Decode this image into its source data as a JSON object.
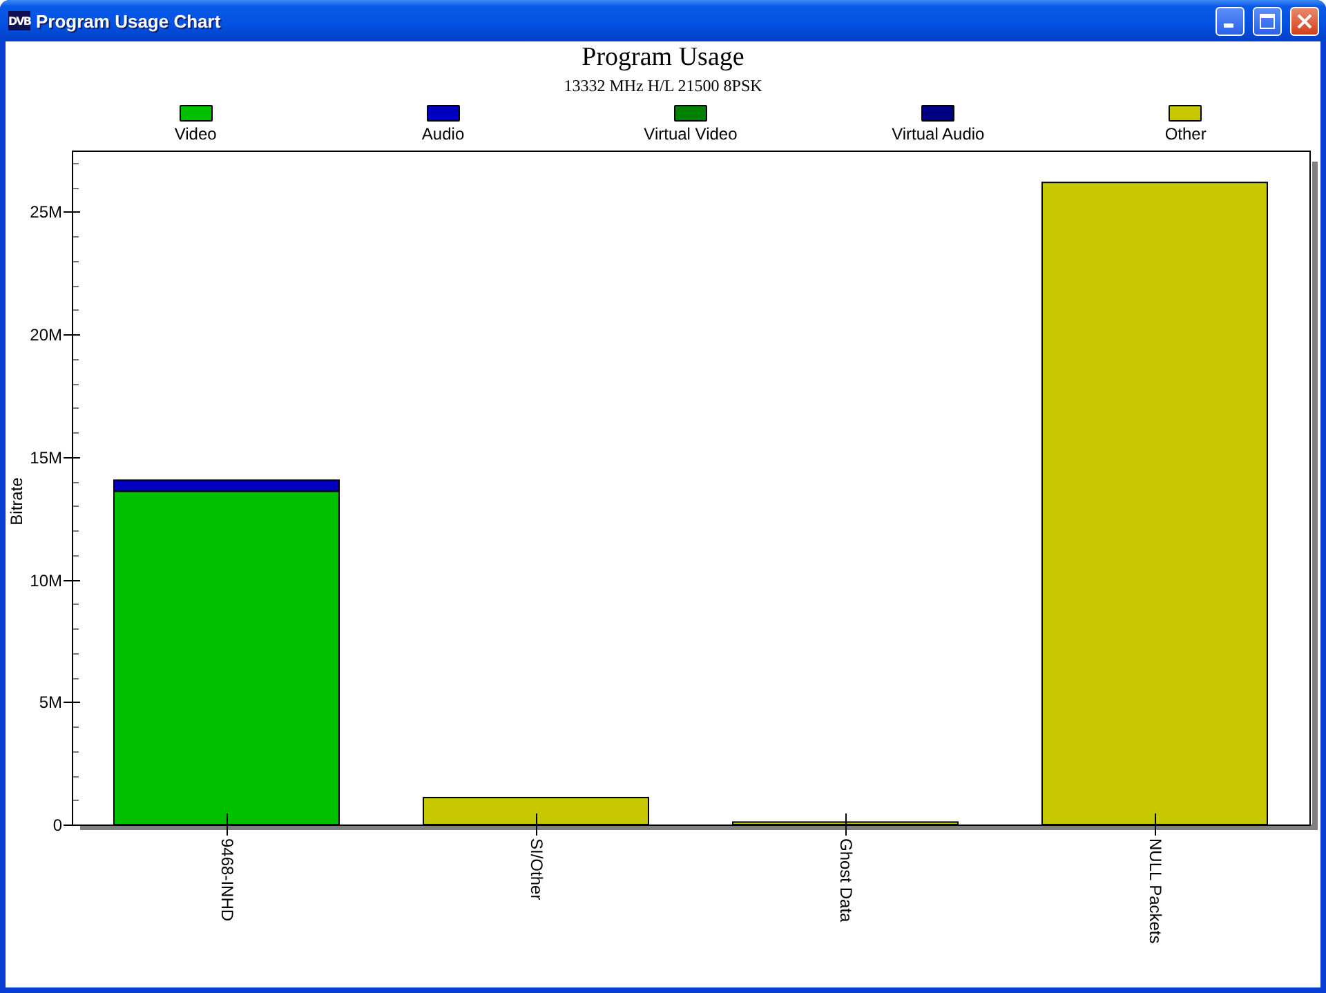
{
  "window": {
    "title": "Program Usage Chart",
    "icon_text": "DVB"
  },
  "chart": {
    "chart_data": {
      "type": "bar",
      "stacked": true,
      "title": "Program Usage",
      "subtitle": "13332 MHz H/L 21500 8PSK",
      "ylabel": "Bitrate",
      "categories": [
        "9468-INHD",
        "SI/Other",
        "Ghost Data",
        "NULL Packets"
      ],
      "series": [
        {
          "name": "Video",
          "color": "#00c000",
          "values": [
            13.6,
            0,
            0,
            0
          ]
        },
        {
          "name": "Audio",
          "color": "#0000c0",
          "values": [
            0.45,
            0,
            0,
            0
          ]
        },
        {
          "name": "Virtual Video",
          "color": "#008000",
          "values": [
            0,
            0,
            0,
            0
          ]
        },
        {
          "name": "Virtual Audio",
          "color": "#000080",
          "values": [
            0,
            0,
            0,
            0
          ]
        },
        {
          "name": "Other",
          "color": "#c8c800",
          "values": [
            0,
            1.1,
            0.1,
            26.2
          ]
        }
      ],
      "ylim": [
        0,
        27.5
      ],
      "yticks": [
        {
          "value": 0,
          "label": "0"
        },
        {
          "value": 5,
          "label": "5M"
        },
        {
          "value": 10,
          "label": "10M"
        },
        {
          "value": 15,
          "label": "15M"
        },
        {
          "value": 20,
          "label": "20M"
        },
        {
          "value": 25,
          "label": "25M"
        }
      ]
    }
  }
}
